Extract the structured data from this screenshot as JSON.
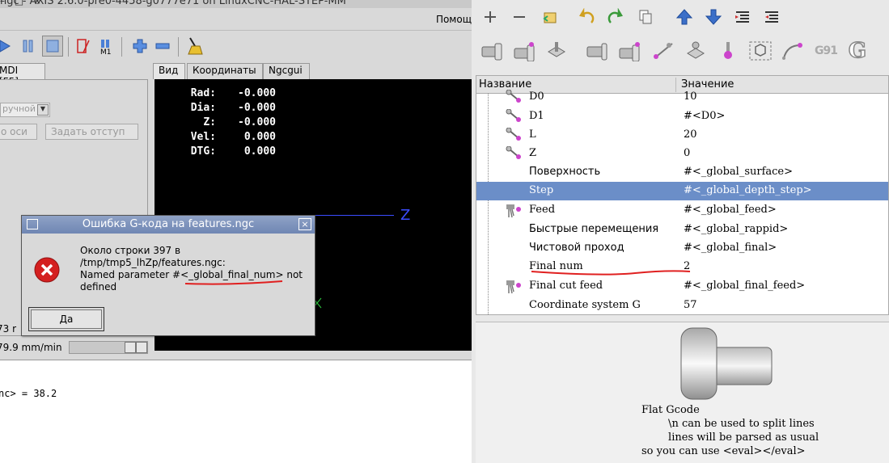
{
  "axis": {
    "title": "ngc - AXIS 2.6.0-pre0-4458-g0777e71 on LinuxCNC-HAL-STEP-MM",
    "window_buttons": "– □ ×",
    "help_menu": "Помощ",
    "left_tab": "MDI [F5]",
    "mode_select": "ручной",
    "btn_zero": "о оси",
    "btn_offset": "Задать отступ",
    "right_tabs": [
      "Вид",
      "Координаты",
      "Ngcgui"
    ],
    "dro": [
      {
        "label": "Rad:",
        "value": "-0.000"
      },
      {
        "label": "Dia:",
        "value": "-0.000"
      },
      {
        "label": "Z:",
        "value": "-0.000"
      },
      {
        "label": "Vel:",
        "value": "0.000"
      },
      {
        "label": "DTG:",
        "value": "0.000"
      }
    ],
    "axis_label": "Z",
    "stat_partial": "73 r",
    "feed_rate": "79.9 mm/min",
    "console_line": "nc> = 38.2"
  },
  "dialog": {
    "title": "Ошибка G-кода на features.ngc",
    "message_line1": "Около строки 397 в",
    "message_line2": "/tmp/tmp5_lhZp/features.ngc:",
    "message_line3_prefix": "Named parameter #",
    "message_line3_param": "<_global_final_num>",
    "message_line3_suffix": " not",
    "message_line4": "defined",
    "ok_label": "Да"
  },
  "features": {
    "columns": {
      "name": "Название",
      "value": "Значение"
    },
    "rows": [
      {
        "name": "D0",
        "value": "10",
        "icon": "param-icon"
      },
      {
        "name": "D1",
        "value": "#<D0>",
        "icon": "param-icon"
      },
      {
        "name": "L",
        "value": "20",
        "icon": "param-icon"
      },
      {
        "name": "Z",
        "value": "0",
        "icon": "param-icon"
      },
      {
        "name": "Поверхность",
        "value": "#<_global_surface>",
        "icon": ""
      },
      {
        "name": "Step",
        "value": "#<_global_depth_step>",
        "icon": ""
      },
      {
        "name": "Feed",
        "value": "#<_global_feed>",
        "icon": "drill-icon"
      },
      {
        "name": "Быстрые перемещения",
        "value": "#<_global_rappid>",
        "icon": ""
      },
      {
        "name": "Чистовой проход",
        "value": "#<_global_final>",
        "icon": ""
      },
      {
        "name": "Final num",
        "value": "2",
        "icon": ""
      },
      {
        "name": "Final cut feed",
        "value": "#<_global_final_feed>",
        "icon": "drill-icon"
      },
      {
        "name": "Coordinate system G",
        "value": "57",
        "icon": ""
      }
    ],
    "selected_row": 5,
    "toolbar2_labels": {
      "g91": "G91",
      "g": "G"
    },
    "preview_text": "Flat Gcode\n        \\n can be used to split lines\n        lines will be parsed as usual\nso you can use <eval></eval>"
  },
  "colors": {
    "selection": "#6b8ec8",
    "error_red": "#d42020",
    "annotation_red": "#e02020",
    "dro_bg": "#000000",
    "axis_blue": "#3b4cff"
  }
}
